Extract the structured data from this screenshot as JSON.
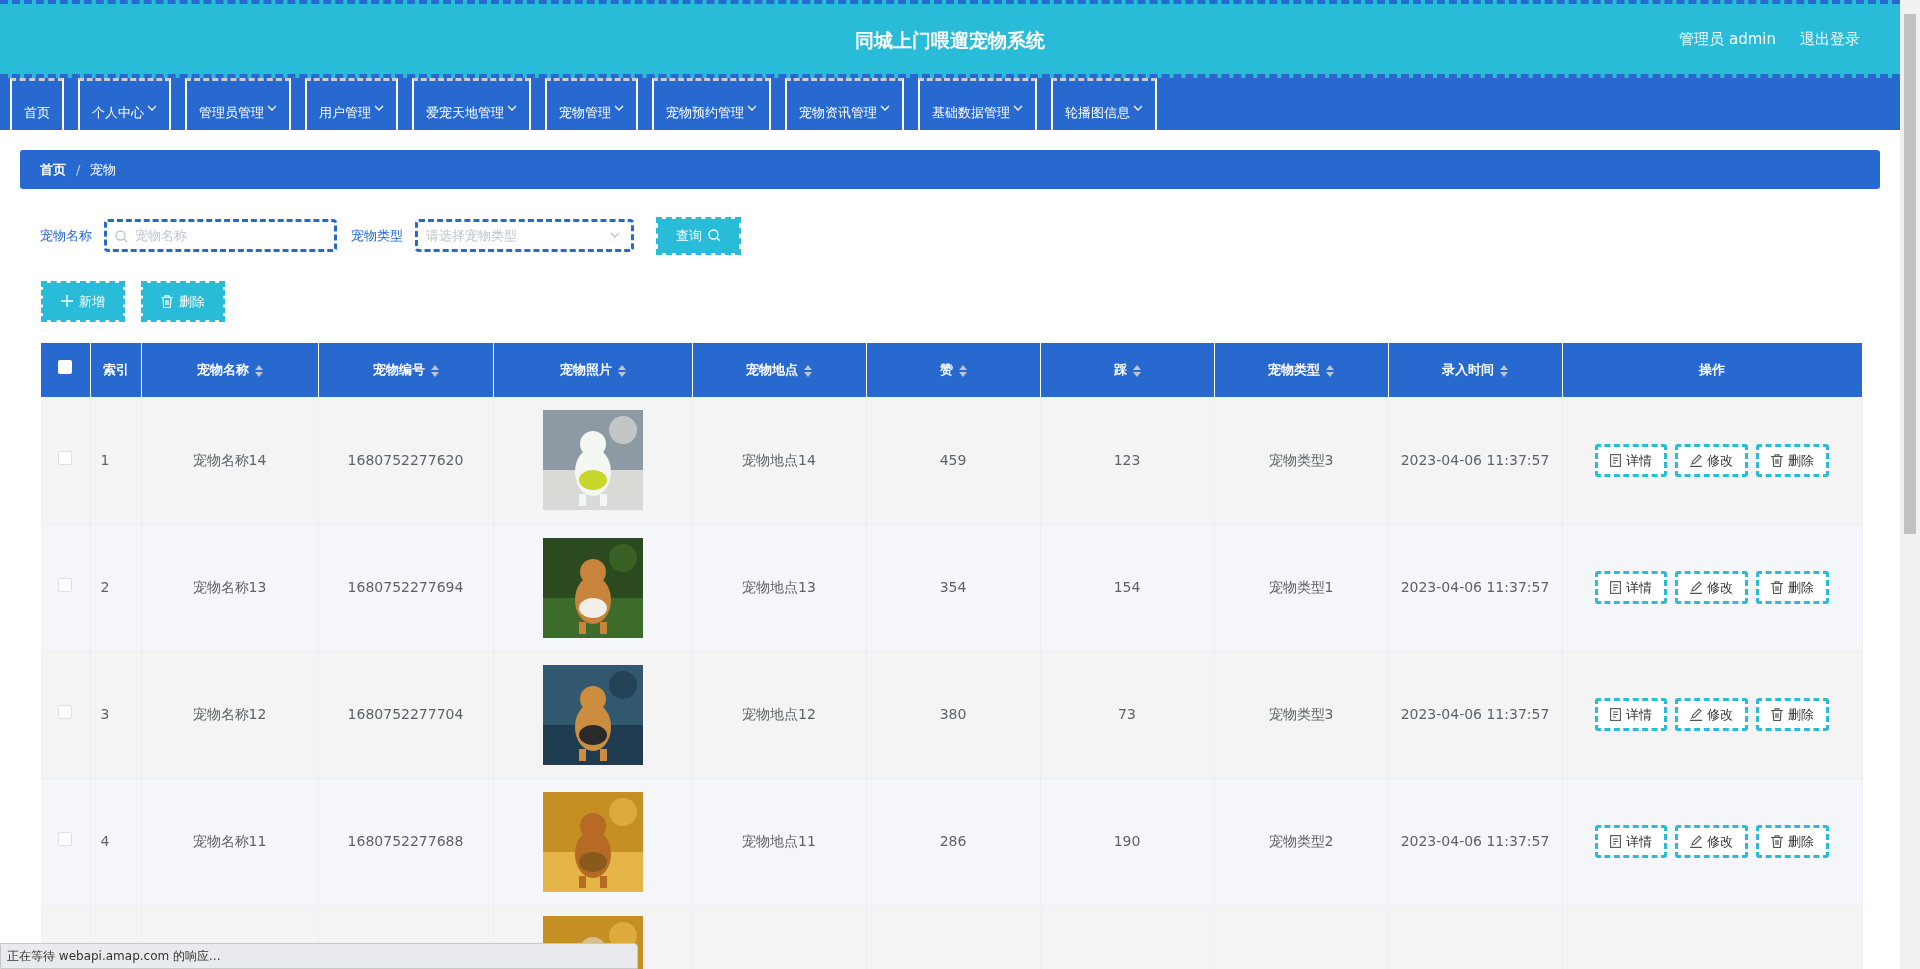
{
  "header": {
    "title": "同城上门喂遛宠物系统",
    "user": "管理员 admin",
    "logout": "退出登录"
  },
  "nav": [
    {
      "label": "首页",
      "dropdown": false
    },
    {
      "label": "个人中心",
      "dropdown": true
    },
    {
      "label": "管理员管理",
      "dropdown": true
    },
    {
      "label": "用户管理",
      "dropdown": true
    },
    {
      "label": "爱宠天地管理",
      "dropdown": true
    },
    {
      "label": "宠物管理",
      "dropdown": true
    },
    {
      "label": "宠物预约管理",
      "dropdown": true
    },
    {
      "label": "宠物资讯管理",
      "dropdown": true
    },
    {
      "label": "基础数据管理",
      "dropdown": true
    },
    {
      "label": "轮播图信息",
      "dropdown": true
    }
  ],
  "breadcrumb": {
    "items": [
      "首页",
      "宠物"
    ],
    "separator": "/"
  },
  "search": {
    "name_label": "宠物名称",
    "name_placeholder": "宠物名称",
    "type_label": "宠物类型",
    "type_placeholder": "请选择宠物类型",
    "query_button": "查询"
  },
  "actions": [
    {
      "kind": "add",
      "label": "新增"
    },
    {
      "kind": "delete",
      "label": "删除"
    }
  ],
  "table": {
    "all_checked": false,
    "columns": [
      {
        "label": "索引",
        "sortable": false
      },
      {
        "label": "宠物名称",
        "sortable": true
      },
      {
        "label": "宠物编号",
        "sortable": true
      },
      {
        "label": "宠物照片",
        "sortable": true
      },
      {
        "label": "宠物地点",
        "sortable": true
      },
      {
        "label": "赞",
        "sortable": true
      },
      {
        "label": "踩",
        "sortable": true
      },
      {
        "label": "宠物类型",
        "sortable": true
      },
      {
        "label": "录入时间",
        "sortable": true
      },
      {
        "label": "操作",
        "sortable": false
      }
    ],
    "rows": [
      {
        "checked": false,
        "index": "1",
        "name": "宠物名称14",
        "code": "1680752277620",
        "photo": {
          "kind": "picture"
        },
        "place": "宠物地点14",
        "likes": "459",
        "dislikes": "123",
        "type": "宠物类型3",
        "time": "2023-04-06 11:37:57",
        "buttons": [
          {
            "kind": "detail",
            "label": "详情"
          },
          {
            "kind": "edit",
            "label": "修改"
          },
          {
            "kind": "delete",
            "label": "删除"
          }
        ]
      },
      {
        "checked": false,
        "index": "2",
        "name": "宠物名称13",
        "code": "1680752277694",
        "photo": {
          "kind": "picture"
        },
        "place": "宠物地点13",
        "likes": "354",
        "dislikes": "154",
        "type": "宠物类型1",
        "time": "2023-04-06 11:37:57",
        "buttons": [
          {
            "kind": "detail",
            "label": "详情"
          },
          {
            "kind": "edit",
            "label": "修改"
          },
          {
            "kind": "delete",
            "label": "删除"
          }
        ]
      },
      {
        "checked": false,
        "index": "3",
        "name": "宠物名称12",
        "code": "1680752277704",
        "photo": {
          "kind": "picture"
        },
        "place": "宠物地点12",
        "likes": "380",
        "dislikes": "73",
        "type": "宠物类型3",
        "time": "2023-04-06 11:37:57",
        "buttons": [
          {
            "kind": "detail",
            "label": "详情"
          },
          {
            "kind": "edit",
            "label": "修改"
          },
          {
            "kind": "delete",
            "label": "删除"
          }
        ]
      },
      {
        "checked": false,
        "index": "4",
        "name": "宠物名称11",
        "code": "1680752277688",
        "photo": {
          "kind": "picture"
        },
        "place": "宠物地点11",
        "likes": "286",
        "dislikes": "190",
        "type": "宠物类型2",
        "time": "2023-04-06 11:37:57",
        "buttons": [
          {
            "kind": "detail",
            "label": "详情"
          },
          {
            "kind": "edit",
            "label": "修改"
          },
          {
            "kind": "delete",
            "label": "删除"
          }
        ]
      }
    ],
    "partial_row": {
      "photo": {
        "kind": "picture"
      }
    }
  },
  "status_bar": "正在等待 webapi.amap.com 的响应..."
}
